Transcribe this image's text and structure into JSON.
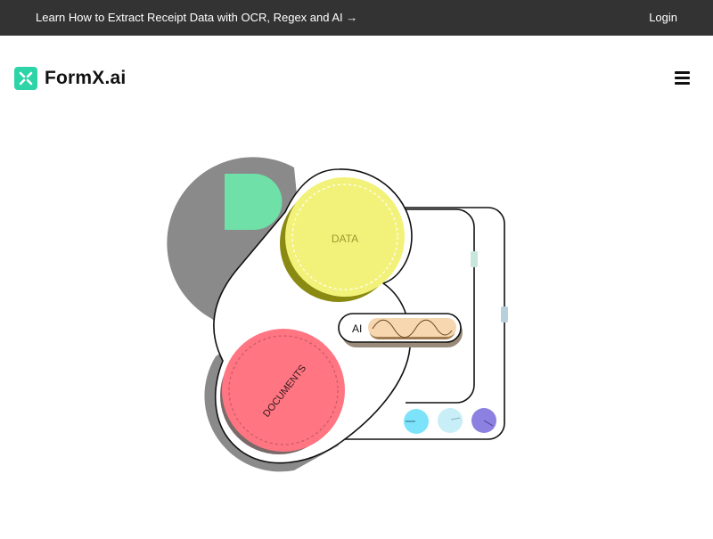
{
  "topbar": {
    "promo_link": "Learn How to Extract Receipt Data with OCR, Regex and AI →",
    "login_link": "Login"
  },
  "header": {
    "logo_text": "FormX.ai",
    "menu_icon": "hamburger-menu-icon"
  },
  "hero": {
    "data_label": "DATA",
    "documents_label": "DOCUMENTS",
    "ai_label": "AI"
  },
  "colors": {
    "topbar_bg": "#333333",
    "logo_accent": "#2DD4A7",
    "data_circle": "#F2F27A",
    "data_shadow": "#8A8A12",
    "documents_circle": "#FF7582",
    "green_tab": "#6EE0A8",
    "dot_cyan": "#7DE3FA",
    "dot_light_cyan": "#C8EEF8",
    "dot_purple": "#8C80E0"
  }
}
